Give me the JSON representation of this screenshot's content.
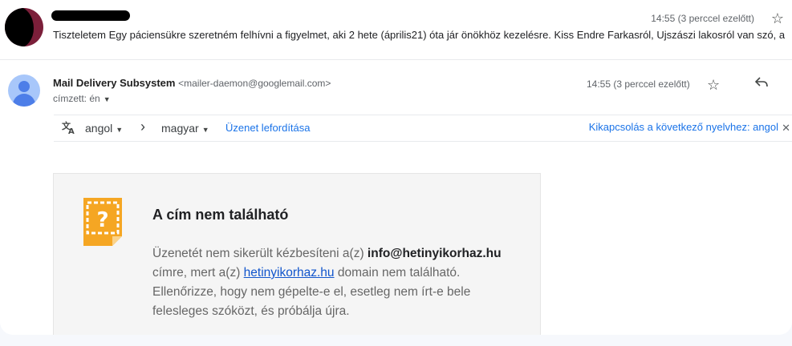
{
  "first_message": {
    "time": "14:55 (3 perccel ezelőtt)",
    "snippet": "Tiszteletem Egy páciensükre szeretném felhívni a figyelmet, aki 2 hete (április21) óta jár önökhöz kezelésre. Kiss Endre Farkasról, Ujszászi lakosról van szó, a"
  },
  "message": {
    "sender_name": "Mail Delivery Subsystem",
    "sender_email": "<mailer-daemon@googlemail.com>",
    "to": "címzett: én",
    "time": "14:55 (3 perccel ezelőtt)"
  },
  "translate": {
    "from": "angol",
    "to": "magyar",
    "translate_link": "Üzenet lefordítása",
    "turn_off_link": "Kikapcsolás a következő nyelvhez: angol"
  },
  "bounce": {
    "title": "A cím nem található",
    "line1_prefix": "Üzenetét nem sikerült kézbesíteni a(z) ",
    "email": "info@hetinyikorhaz.hu",
    "line2_prefix": "címre, mert a(z) ",
    "domain": "hetinyikorhaz.hu",
    "line2_suffix": " domain nem található.",
    "line3": "Ellenőrizze, hogy nem gépelte-e el, esetleg nem írt-e bele",
    "line4": "felesleges szóközt, és próbálja újra."
  },
  "icons": {
    "star": "star-icon",
    "reply": "reply-icon",
    "translate": "translate-icon",
    "note": "help-note-icon"
  },
  "colors": {
    "link": "#1a73e8",
    "note_orange": "#f5a623",
    "avatar_blue": "#a8c7fa"
  }
}
